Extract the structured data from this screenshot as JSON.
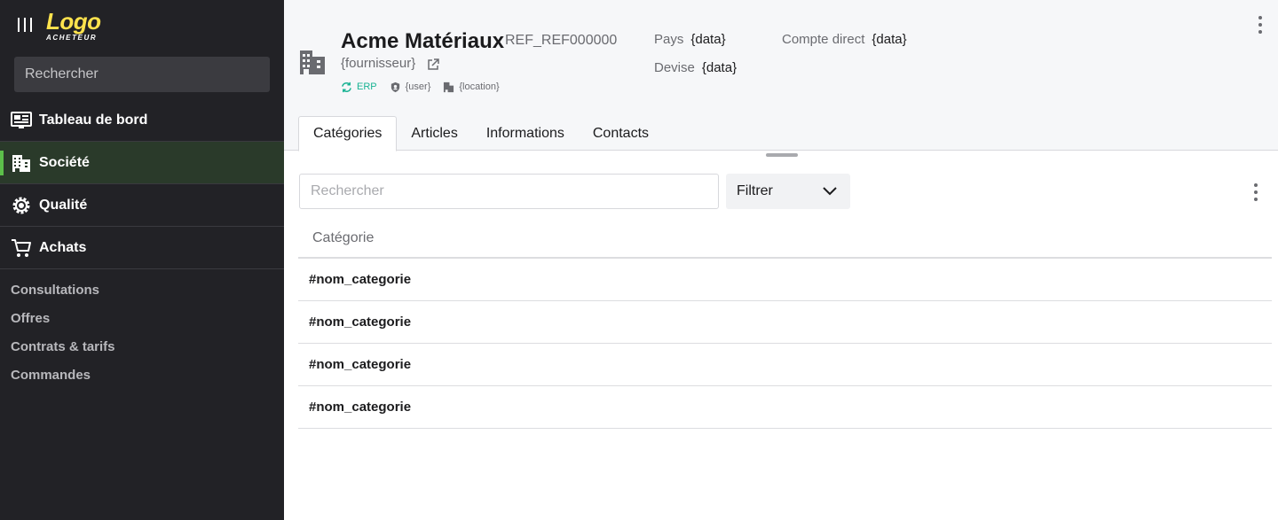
{
  "sidebar": {
    "logo": {
      "name": "Logo",
      "subtitle": "ACHETEUR"
    },
    "search": {
      "placeholder": "Rechercher"
    },
    "nav": [
      {
        "label": "Tableau de bord",
        "icon": "dashboard-icon"
      },
      {
        "label": "Société",
        "icon": "building-icon",
        "active": true
      },
      {
        "label": "Qualité",
        "icon": "quality-gear-icon"
      },
      {
        "label": "Achats",
        "icon": "cart-icon"
      }
    ],
    "sub_items": [
      "Consultations",
      "Offres",
      "Contrats & tarifs",
      "Commandes"
    ]
  },
  "header": {
    "title": "Acme Matériaux",
    "ref": "REF_REF000000",
    "supplier": "{fournisseur}",
    "meta": {
      "erp": "ERP",
      "user": "{user}",
      "location": "{location}"
    },
    "fields": {
      "pays": {
        "label": "Pays",
        "value": "{data}"
      },
      "devise": {
        "label": "Devise",
        "value": "{data}"
      },
      "compte": {
        "label": "Compte direct",
        "value": "{data}"
      }
    }
  },
  "tabs": [
    {
      "label": "Catégories",
      "active": true
    },
    {
      "label": "Articles"
    },
    {
      "label": "Informations"
    },
    {
      "label": "Contacts"
    }
  ],
  "toolbar": {
    "search_placeholder": "Rechercher",
    "filter_label": "Filtrer"
  },
  "table": {
    "column": "Catégorie",
    "rows": [
      "#nom_categorie",
      "#nom_categorie",
      "#nom_categorie",
      "#nom_categorie"
    ]
  },
  "colors": {
    "sidebar_bg": "#222226",
    "logo": "#ffe34d",
    "active_accent": "#5cc04a",
    "erp": "#1ab394"
  }
}
